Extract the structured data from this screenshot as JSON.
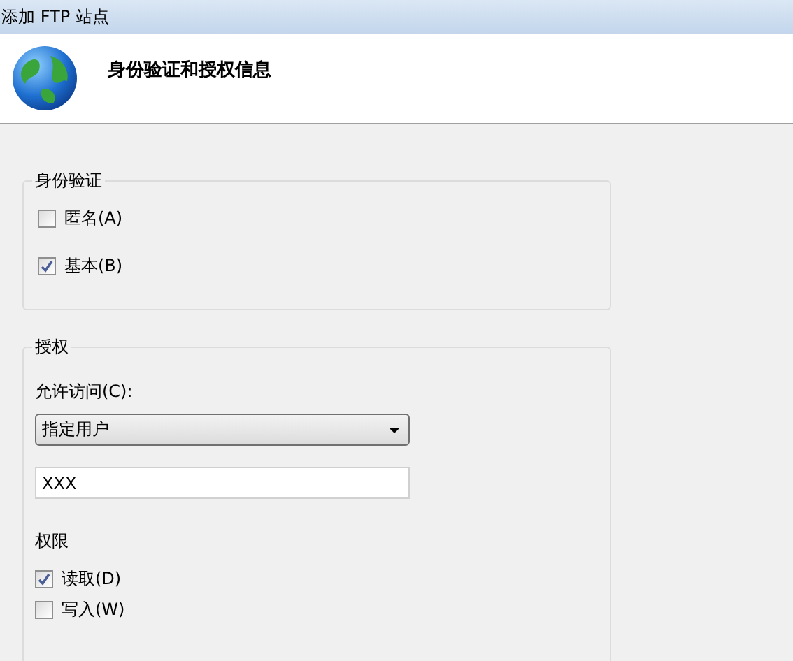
{
  "window": {
    "title": "添加 FTP 站点"
  },
  "header": {
    "title": "身份验证和授权信息"
  },
  "authentication": {
    "legend": "身份验证",
    "options": [
      {
        "label": "匿名(A)",
        "checked": false
      },
      {
        "label": "基本(B)",
        "checked": true
      }
    ]
  },
  "authorization": {
    "legend": "授权",
    "access_label": "允许访问(C):",
    "access_dropdown": {
      "value": "指定用户"
    },
    "users_field": {
      "value": "XXX"
    },
    "permissions_label": "权限",
    "permissions": [
      {
        "label": "读取(D)",
        "checked": true
      },
      {
        "label": "写入(W)",
        "checked": false
      }
    ]
  }
}
